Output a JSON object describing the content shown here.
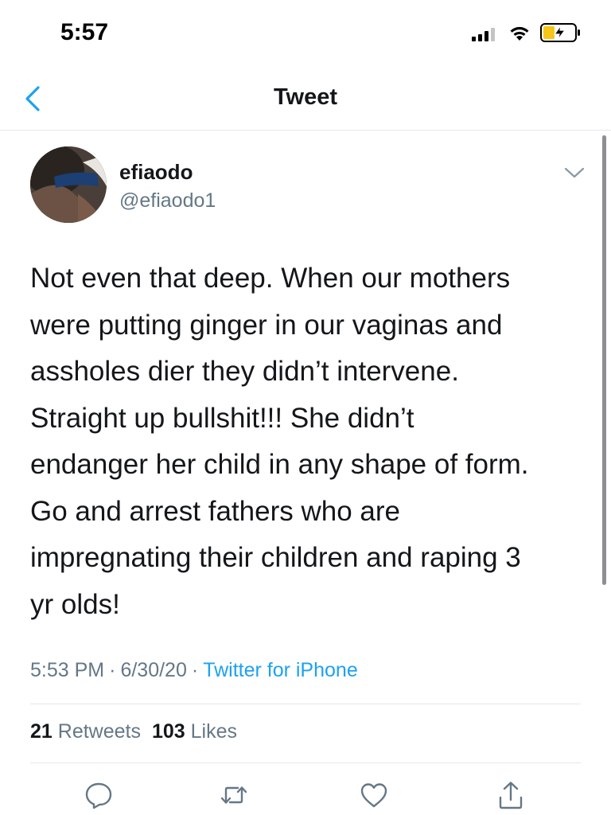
{
  "status_bar": {
    "time": "5:57",
    "icons": [
      "signal-icon",
      "wifi-icon",
      "battery-charging-icon"
    ]
  },
  "nav": {
    "back_icon": "chevron-left-icon",
    "title": "Tweet"
  },
  "tweet": {
    "author": {
      "display_name": "efiaodo",
      "handle": "@efiaodo1"
    },
    "text_lines": [
      "Not even that deep. When our mothers",
      "were putting ginger in our vaginas and",
      "assholes dier they didn’t intervene.",
      "Straight up bullshit!!! She didn’t",
      "endanger her child in any shape of form.",
      "Go and arrest fathers who are",
      "impregnating their children and raping 3",
      "yr olds!"
    ],
    "time": "5:53 PM",
    "date": "6/30/20",
    "separator": "·",
    "source": "Twitter for iPhone",
    "retweets_count": "21",
    "retweets_label": "Retweets",
    "likes_count": "103",
    "likes_label": "Likes"
  },
  "actions": [
    "reply-icon",
    "retweet-icon",
    "like-icon",
    "share-icon"
  ],
  "colors": {
    "accent": "#1da1f2",
    "secondary_text": "#657786",
    "primary_text": "#14171a",
    "divider": "#e1e8ed"
  }
}
